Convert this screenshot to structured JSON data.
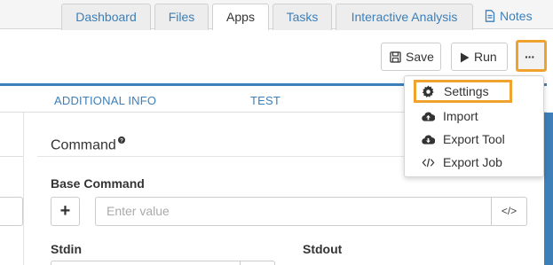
{
  "nav": {
    "tabs": [
      {
        "label": "Dashboard"
      },
      {
        "label": "Files"
      },
      {
        "label": "Apps"
      },
      {
        "label": "Tasks"
      },
      {
        "label": "Interactive Analysis"
      }
    ],
    "active_tab": "Apps",
    "notes_label": "Notes"
  },
  "toolbar": {
    "save_label": "Save",
    "run_label": "Run",
    "more_label": "···"
  },
  "subtabs": [
    {
      "label": "ADDITIONAL INFO"
    },
    {
      "label": "TEST"
    }
  ],
  "menu": {
    "items": [
      {
        "label": "Settings",
        "icon": "gear-icon"
      },
      {
        "label": "Import",
        "icon": "cloud-upload-icon"
      },
      {
        "label": "Export Tool",
        "icon": "cloud-download-icon"
      },
      {
        "label": "Export Job",
        "icon": "code-icon"
      }
    ],
    "highlighted_item": "Settings"
  },
  "command": {
    "title": "Command",
    "help_icon": "?",
    "base_command_label": "Base Command",
    "add_button": "+",
    "value_placeholder": "Enter value",
    "code_button": "</>",
    "stdin_label": "Stdin",
    "stdout_label": "Stdout"
  },
  "colors": {
    "accent_blue": "#3d7fb8",
    "highlight_orange": "#f0a22e"
  }
}
